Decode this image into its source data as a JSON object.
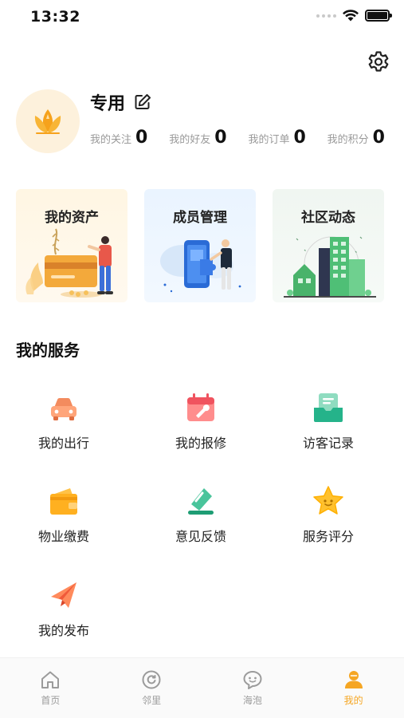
{
  "status_bar": {
    "time": "13:32"
  },
  "profile": {
    "name": "专用",
    "stats": [
      {
        "label": "我的关注",
        "value": "0"
      },
      {
        "label": "我的好友",
        "value": "0"
      },
      {
        "label": "我的订单",
        "value": "0"
      },
      {
        "label": "我的积分",
        "value": "0"
      }
    ]
  },
  "cards": [
    {
      "title": "我的资产",
      "icon": "assets-illustration"
    },
    {
      "title": "成员管理",
      "icon": "members-illustration"
    },
    {
      "title": "社区动态",
      "icon": "community-illustration"
    }
  ],
  "services": {
    "title": "我的服务",
    "items": [
      {
        "label": "我的出行",
        "icon": "car-icon"
      },
      {
        "label": "我的报修",
        "icon": "repair-icon"
      },
      {
        "label": "访客记录",
        "icon": "visitor-icon"
      },
      {
        "label": "物业缴费",
        "icon": "wallet-icon"
      },
      {
        "label": "意见反馈",
        "icon": "feedback-icon"
      },
      {
        "label": "服务评分",
        "icon": "star-icon"
      },
      {
        "label": "我的发布",
        "icon": "send-icon"
      }
    ]
  },
  "tab_bar": {
    "tabs": [
      {
        "label": "首页",
        "icon": "home-icon",
        "active": false
      },
      {
        "label": "邻里",
        "icon": "neighbor-icon",
        "active": false
      },
      {
        "label": "海泡",
        "icon": "bubble-icon",
        "active": false
      },
      {
        "label": "我的",
        "icon": "profile-icon",
        "active": true
      }
    ]
  },
  "colors": {
    "accent": "#f5a623",
    "inactive": "#9b9b9b",
    "title": "#111111"
  }
}
